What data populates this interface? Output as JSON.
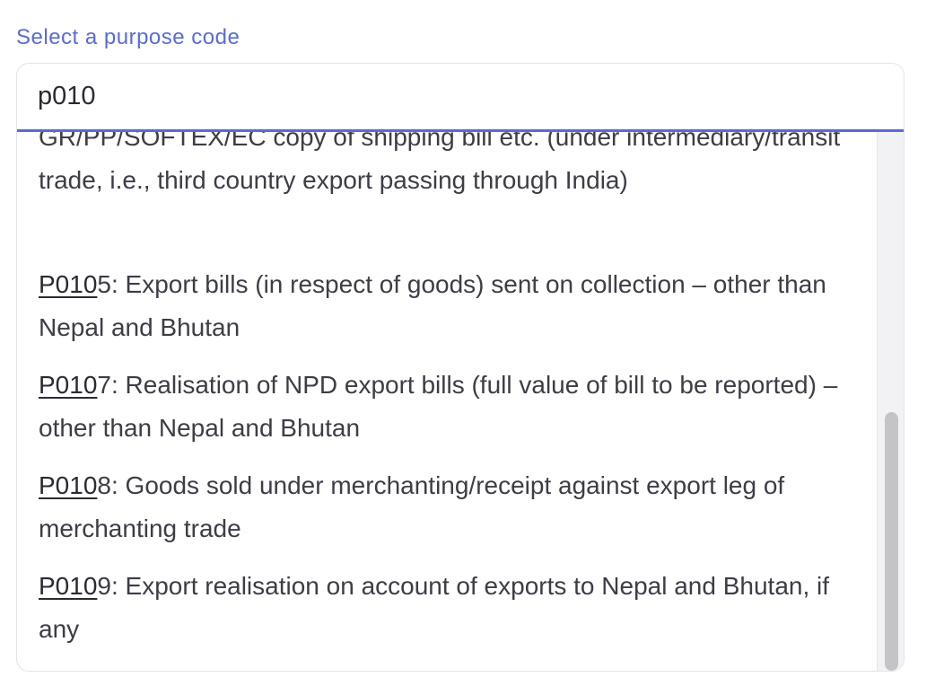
{
  "field": {
    "label": "Select a purpose code",
    "search_value": "p010"
  },
  "options": [
    {
      "code_match": "",
      "code_rest": "",
      "text": "GR/PP/SOFTEX/EC copy of shipping bill etc. (under intermediary/transit trade, i.e., third country export passing through India)"
    },
    {
      "code_match": "P010",
      "code_rest": "5",
      "text": ": Export bills (in respect of goods) sent on collection – other than Nepal and Bhutan"
    },
    {
      "code_match": "P010",
      "code_rest": "7",
      "text": ": Realisation of NPD export bills (full value of bill to be reported) – other than Nepal and Bhutan"
    },
    {
      "code_match": "P010",
      "code_rest": "8",
      "text": ": Goods sold under merchanting/receipt against export leg of merchanting trade"
    },
    {
      "code_match": "P010",
      "code_rest": "9",
      "text": ": Export realisation on account of exports to Nepal and Bhutan, if any"
    }
  ]
}
